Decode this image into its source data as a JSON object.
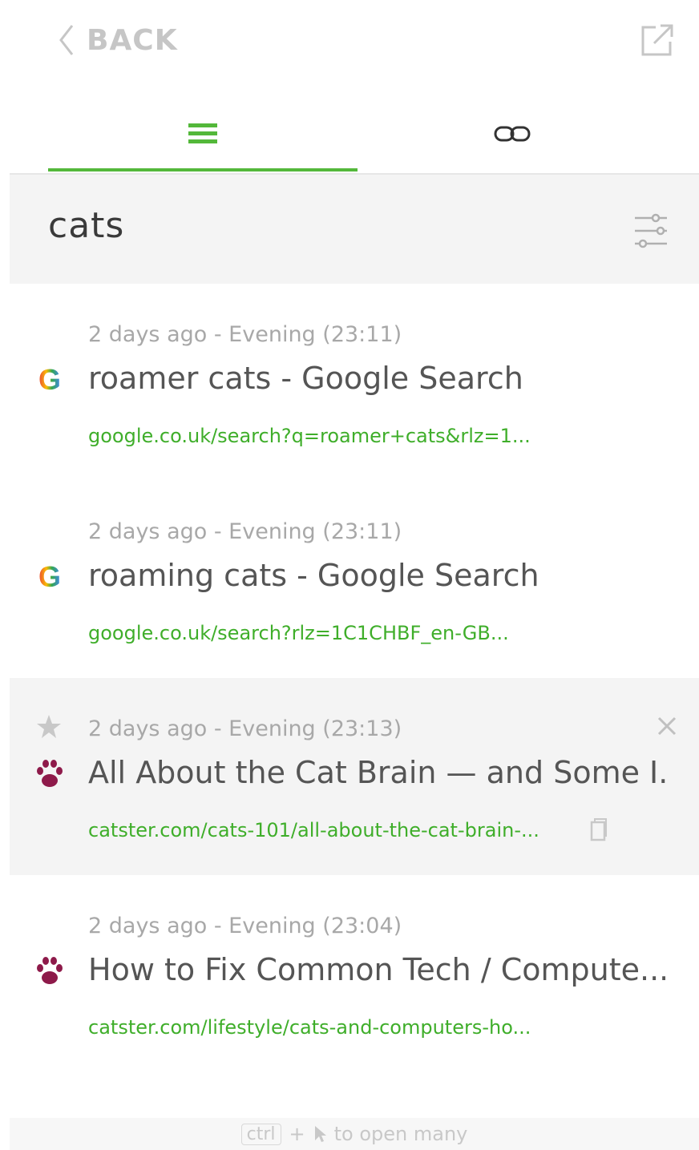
{
  "topbar": {
    "back_label": "BACK"
  },
  "tabs": [
    {
      "name": "list",
      "icon": "list-icon",
      "active": true
    },
    {
      "name": "link",
      "icon": "link-icon",
      "active": false
    }
  ],
  "search": {
    "query": "cats"
  },
  "results": [
    {
      "time": "2 days ago - Evening (23:11)",
      "title": "roamer cats - Google Search",
      "url": "google.co.uk/search?q=roamer+cats&rlz=1...",
      "favicon": "google-icon"
    },
    {
      "time": "2 days ago - Evening (23:11)",
      "title": "roaming cats - Google Search",
      "url": "google.co.uk/search?rlz=1C1CHBF_en-GB...",
      "favicon": "google-icon"
    },
    {
      "time": "2 days ago - Evening (23:13)",
      "title": "All About the Cat Brain — and Some I...",
      "url": "catster.com/cats-101/all-about-the-cat-brain-...",
      "favicon": "paw-icon",
      "hovered": true
    },
    {
      "time": "2 days ago - Evening (23:04)",
      "title": "How to Fix Common Tech / Compute...",
      "url": "catster.com/lifestyle/cats-and-computers-ho...",
      "favicon": "paw-icon"
    }
  ],
  "footer": {
    "key": "ctrl",
    "plus": "+",
    "hint": "to open many"
  },
  "colors": {
    "accent": "#53b83a",
    "url_green": "#3fae2a",
    "paw": "#8e1a4a",
    "muted": "#a8a8a8"
  }
}
